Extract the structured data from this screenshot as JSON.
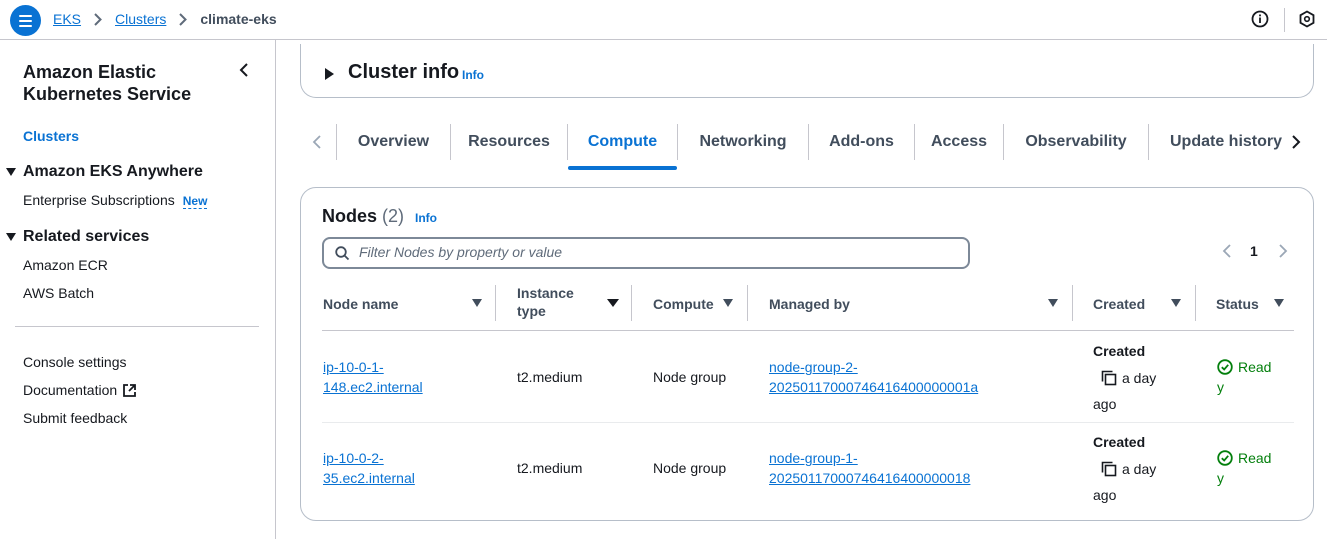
{
  "breadcrumb": [
    "EKS",
    "Clusters",
    "climate-eks"
  ],
  "sidebar": {
    "title": "Amazon Elastic Kubernetes Service",
    "active_item": "Clusters",
    "sections": [
      {
        "title": "Amazon EKS Anywhere",
        "items": [
          {
            "label": "Enterprise Subscriptions",
            "badge": "New"
          }
        ]
      },
      {
        "title": "Related services",
        "items": [
          {
            "label": "Amazon ECR"
          },
          {
            "label": "AWS Batch"
          }
        ]
      }
    ],
    "footer_items": [
      "Console settings",
      "Documentation",
      "Submit feedback"
    ]
  },
  "cluster_info": {
    "title": "Cluster info",
    "info": "Info"
  },
  "tabs": [
    "Overview",
    "Resources",
    "Compute",
    "Networking",
    "Add-ons",
    "Access",
    "Observability",
    "Update history"
  ],
  "active_tab": "Compute",
  "nodes": {
    "title": "Nodes",
    "count": "(2)",
    "info": "Info",
    "filter_placeholder": "Filter Nodes by property or value",
    "page": "1",
    "columns": [
      "Node name",
      "Instance type",
      "Compute",
      "Managed by",
      "Created",
      "Status"
    ],
    "rows": [
      {
        "name_line1": "ip-10-0-1-",
        "name_line2": "148.ec2.internal",
        "instance_type": "t2.medium",
        "compute": "Node group",
        "managed_line1": "node-group-2-",
        "managed_line2": "20250117000746416400000001a",
        "created_label": "Created",
        "created_rel1": "a day",
        "created_rel2": "ago",
        "status_line1": "Read",
        "status_line2": "y"
      },
      {
        "name_line1": "ip-10-0-2-",
        "name_line2": "35.ec2.internal",
        "instance_type": "t2.medium",
        "compute": "Node group",
        "managed_line1": "node-group-1-",
        "managed_line2": "20250117000746416400000018",
        "created_label": "Created",
        "created_rel1": "a day",
        "created_rel2": "ago",
        "status_line1": "Read",
        "status_line2": "y"
      }
    ]
  },
  "colors": {
    "accent": "#0972d3",
    "success": "#037f0c",
    "border": "#c6c6cd"
  }
}
